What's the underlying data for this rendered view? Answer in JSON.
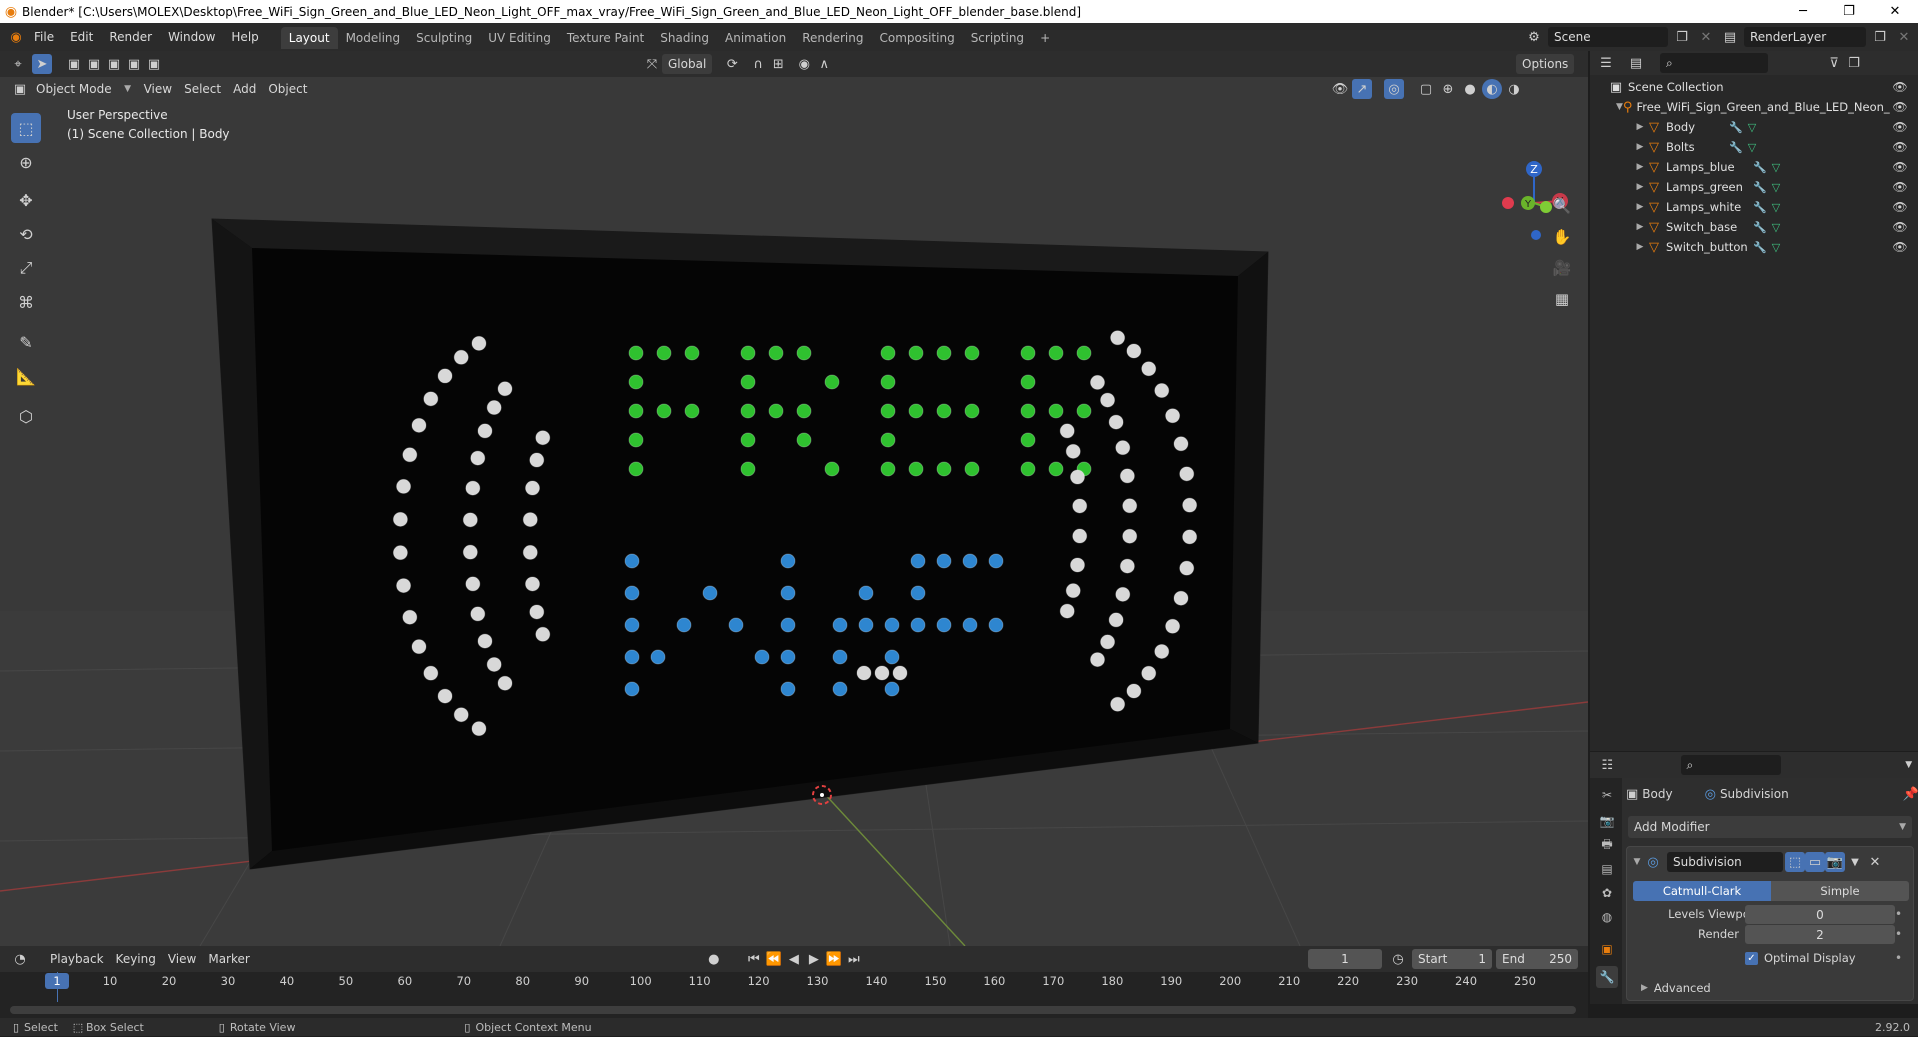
{
  "window": {
    "title": "Blender* [C:\\Users\\MOLEX\\Desktop\\Free_WiFi_Sign_Green_and_Blue_LED_Neon_Light_OFF_max_vray/Free_WiFi_Sign_Green_and_Blue_LED_Neon_Light_OFF_blender_base.blend]",
    "minimize": "─",
    "maximize": "❐",
    "close": "✕"
  },
  "menus": [
    "File",
    "Edit",
    "Render",
    "Window",
    "Help"
  ],
  "workspaces": [
    "Layout",
    "Modeling",
    "Sculpting",
    "UV Editing",
    "Texture Paint",
    "Shading",
    "Animation",
    "Rendering",
    "Compositing",
    "Scripting"
  ],
  "workspace_add": "+",
  "scene": {
    "name": "Scene",
    "layer": "RenderLayer"
  },
  "viewport": {
    "transform_orientation": "Global",
    "options": "Options",
    "mode": "Object Mode",
    "menu": [
      "View",
      "Select",
      "Add",
      "Object"
    ],
    "overlay_title": "User Perspective",
    "overlay_subtitle": "(1) Scene Collection | Body",
    "gizmo": {
      "z": "Z",
      "y": "Y",
      "x": "X"
    }
  },
  "sign_rows": {
    "green": [
      ".OOO.OOO..OOOO.OOO",
      ".O...O..O.O....O..",
      ".OOO.OOO..OOOO.OOO",
      ".O...O.O..O....O..",
      ".O...O..O.OOOO.OOO"
    ],
    "blue": [
      "O.....O....OOOO",
      "O..O..O..O.O...",
      "O.O.O.O.OOOOOOO",
      "OO...OO.O.O....",
      "O.....O.O.O...."
    ]
  },
  "outliner": {
    "root": "Scene Collection",
    "collection": "Free_WiFi_Sign_Green_and_Blue_LED_Neon_",
    "objects": [
      "Body",
      "Bolts",
      "Lamps_blue",
      "Lamps_green",
      "Lamps_white",
      "Switch_base",
      "Switch_button"
    ]
  },
  "properties": {
    "object": "Body",
    "modifier_tab": "Subdivision",
    "add_modifier": "Add Modifier",
    "modifier_name": "Subdivision",
    "modes": [
      "Catmull-Clark",
      "Simple"
    ],
    "levels_viewport_label": "Levels Viewport",
    "levels_viewport": "0",
    "render_label": "Render",
    "render": "2",
    "optimal_display": "Optimal Display",
    "advanced": "Advanced"
  },
  "timeline": {
    "menus": [
      "Playback",
      "Keying",
      "View",
      "Marker"
    ],
    "current": "1",
    "start_label": "Start",
    "start": "1",
    "end_label": "End",
    "end": "250",
    "ticks": [
      "1",
      "10",
      "20",
      "30",
      "40",
      "50",
      "60",
      "70",
      "80",
      "90",
      "100",
      "110",
      "120",
      "130",
      "140",
      "150",
      "160",
      "170",
      "180",
      "190",
      "200",
      "210",
      "220",
      "230",
      "240",
      "250"
    ]
  },
  "status": {
    "select": "Select",
    "box_select": "Box Select",
    "rotate": "Rotate View",
    "context": "Object Context Menu",
    "version": "2.92.0"
  },
  "colors": {
    "green_led": "#2fc12f",
    "blue_led": "#2e86d0",
    "white_led": "#d8d8d8",
    "accent": "#4772b3",
    "orange": "#e87d0d"
  }
}
